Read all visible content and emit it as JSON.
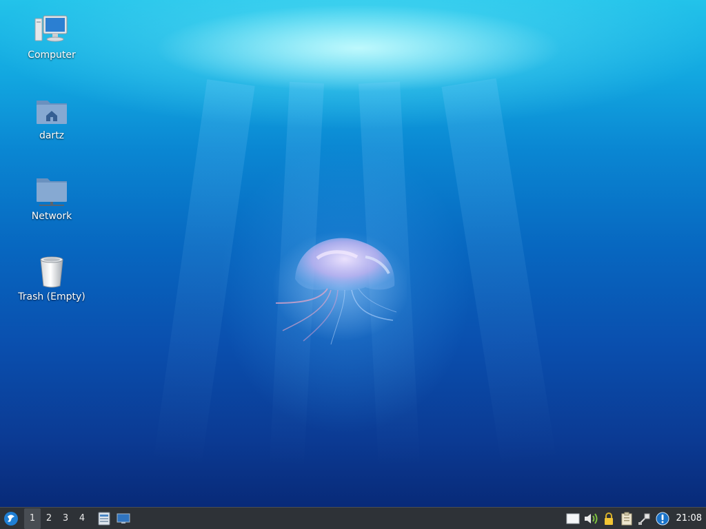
{
  "desktop": {
    "icons": [
      {
        "label": "Computer",
        "icon": "computer-icon"
      },
      {
        "label": "dartz",
        "icon": "home-folder-icon"
      },
      {
        "label": "Network",
        "icon": "network-folder-icon"
      },
      {
        "label": "Trash (Empty)",
        "icon": "trash-icon"
      }
    ]
  },
  "taskbar": {
    "start_icon": "lubuntu-menu-icon",
    "workspaces": [
      "1",
      "2",
      "3",
      "4"
    ],
    "active_workspace": "1",
    "launchers": [
      {
        "icon": "file-manager-icon"
      },
      {
        "icon": "show-desktop-icon"
      }
    ],
    "tray": [
      {
        "icon": "removable-drive-icon"
      },
      {
        "icon": "volume-icon"
      },
      {
        "icon": "lock-screen-icon"
      },
      {
        "icon": "clipboard-icon"
      },
      {
        "icon": "network-status-icon"
      },
      {
        "icon": "update-notifier-icon"
      }
    ],
    "clock": "21:08"
  },
  "colors": {
    "taskbar_bg": "#2e3237",
    "water_top": "#23c3ea",
    "water_bottom": "#082a78",
    "update_badge": "#1a73c9"
  }
}
